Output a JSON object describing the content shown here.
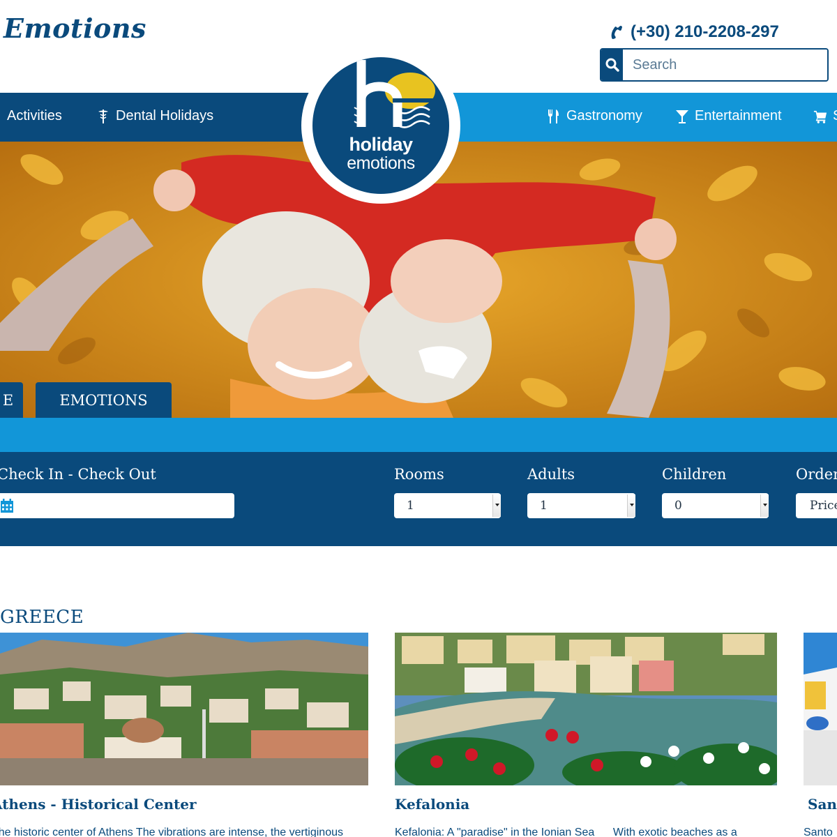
{
  "header": {
    "brand": "Emotions",
    "phone": "(+30) 210-2208-297",
    "search_placeholder": "Search"
  },
  "nav": {
    "left": [
      {
        "label": "Activities",
        "icon": "activities-icon"
      },
      {
        "label": "Dental Holidays",
        "icon": "caduceus-icon"
      }
    ],
    "right": [
      {
        "label": "Gastronomy",
        "icon": "fork-knife-icon"
      },
      {
        "label": "Entertainment",
        "icon": "cocktail-icon"
      },
      {
        "label": "S",
        "icon": "cart-icon"
      }
    ]
  },
  "logo": {
    "mark": "he",
    "line1": "holiday",
    "line2": "emotions"
  },
  "tabs": [
    "E",
    "EMOTIONS"
  ],
  "booking": {
    "dates_label": "Check In - Check Out",
    "rooms_label": "Rooms",
    "rooms_value": "1",
    "adults_label": "Adults",
    "adults_value": "1",
    "children_label": "Children",
    "children_value": "0",
    "order_label": "Order",
    "order_value": "Price"
  },
  "section_title": "GREECE",
  "cards": [
    {
      "title": "Athens - Historical Center",
      "text": "The historic center of Athens The vibrations are intense, the vertiginous"
    },
    {
      "title": "Kefalonia",
      "text": "Kefalonia: A \"paradise\" in the Ionian Sea      With exotic beaches as a"
    },
    {
      "title": "Sant",
      "text": "Santo"
    }
  ],
  "colors": {
    "navy": "#0a4a7c",
    "sky": "#1296d8",
    "logo_accent": "#e8c320"
  }
}
